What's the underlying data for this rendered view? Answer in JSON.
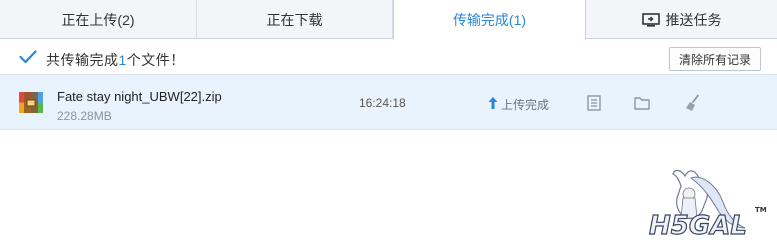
{
  "tabs": [
    {
      "label": "正在上传(2)"
    },
    {
      "label": "正在下载"
    },
    {
      "label": "传输完成(1)"
    },
    {
      "label": "推送任务"
    }
  ],
  "summary": {
    "prefix": "共传输完成",
    "count": "1",
    "suffix": "个文件！",
    "clear_label": "清除所有记录"
  },
  "files": [
    {
      "name": "Fate stay night_UBW[22].zip",
      "size": "228.28MB",
      "time": "16:24:18",
      "status": "上传完成"
    }
  ],
  "watermark": {
    "text": "H5GAL",
    "tm": "TM"
  },
  "colors": {
    "accent": "#2a86d8",
    "row_bg": "#e9f3fd",
    "tab_bg": "#f3f5f8"
  },
  "icons": {
    "check": "check-icon",
    "zip": "zip-file-icon",
    "upload_arrow": "up-arrow-icon",
    "details": "document-icon",
    "folder": "folder-icon",
    "clean": "broom-icon",
    "push": "monitor-push-icon"
  }
}
